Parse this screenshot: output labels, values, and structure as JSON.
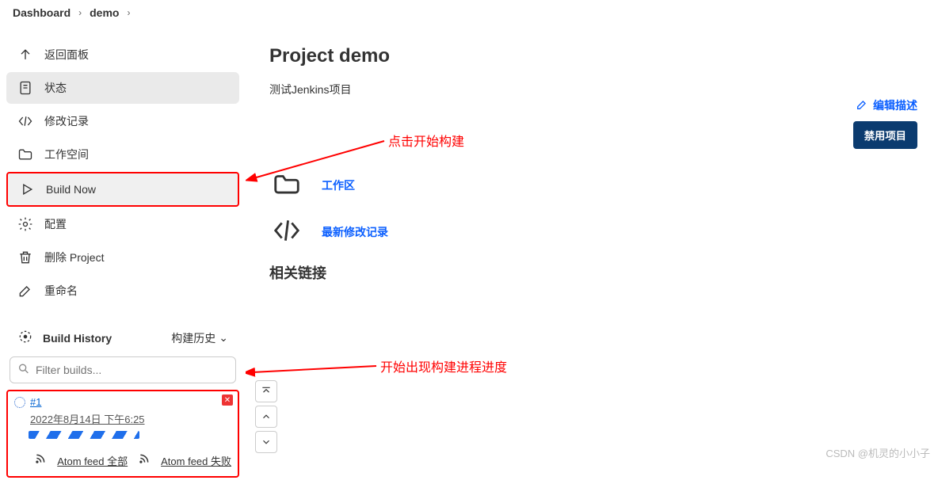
{
  "breadcrumb": {
    "items": [
      "Dashboard",
      "demo"
    ]
  },
  "sidebar": {
    "back": "返回面板",
    "status": "状态",
    "changes": "修改记录",
    "workspace": "工作空间",
    "build_now": "Build Now",
    "configure": "配置",
    "delete": "删除 Project",
    "rename": "重命名"
  },
  "build_history": {
    "title": "Build History",
    "trend_label": "构建历史",
    "filter_placeholder": "Filter builds...",
    "build": {
      "num": "#1",
      "date": "2022年8月14日 下午6:25"
    },
    "feed_all": "Atom feed 全部",
    "feed_fail": "Atom feed 失败"
  },
  "content": {
    "title": "Project demo",
    "description": "测试Jenkins项目",
    "workspace_link": "工作区",
    "changes_link": "最新修改记录",
    "related_links": "相关链接",
    "edit_desc": "编辑描述",
    "disable": "禁用项目"
  },
  "annotations": {
    "a1": "点击开始构建",
    "a2": "开始出现构建进程进度"
  },
  "watermark": "CSDN @机灵的小小子"
}
